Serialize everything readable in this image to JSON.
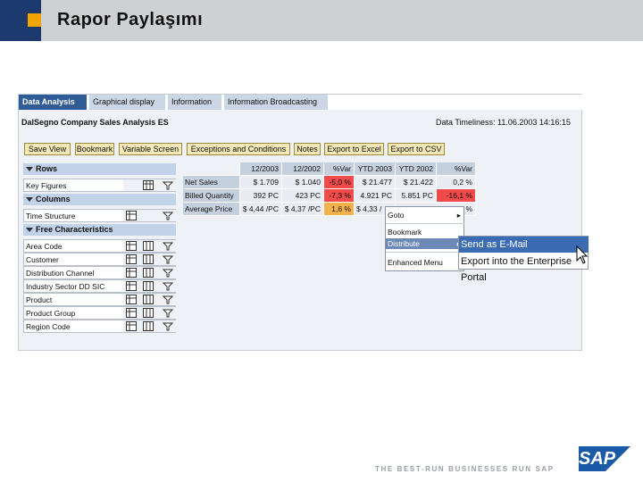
{
  "slide": {
    "title": "Rapor Paylaşımı",
    "tagline": "THE BEST-RUN BUSINESSES RUN SAP",
    "logo_text": "SAP"
  },
  "colors": {
    "header_bg": "#cfd0d2",
    "accent_blue": "#1c3a6e",
    "accent_orange": "#f0a500",
    "negative": "#f04a4a",
    "warning": "#f5b24a"
  },
  "tabs": [
    {
      "label": "Data Analysis"
    },
    {
      "label": "Graphical display"
    },
    {
      "label": "Information"
    },
    {
      "label": "Information Broadcasting"
    }
  ],
  "report": {
    "title": "DalSegno Company Sales Analysis ES",
    "timeliness": "Data Timeliness: 11.06.2003 14:16:15"
  },
  "toolbar": [
    {
      "label": "Save View"
    },
    {
      "label": "Bookmark"
    },
    {
      "label": "Variable Screen"
    },
    {
      "label": "Exceptions and Conditions"
    },
    {
      "label": "Notes"
    },
    {
      "label": "Export to Excel"
    },
    {
      "label": "Export to CSV"
    }
  ],
  "navigation": {
    "rows_header": "Rows",
    "rows": [
      {
        "label": "Key Figures"
      }
    ],
    "columns_header": "Columns",
    "columns": [
      {
        "label": "Time Structure"
      }
    ],
    "free_header": "Free Characteristics",
    "free": [
      {
        "label": "Area Code"
      },
      {
        "label": "Customer"
      },
      {
        "label": "Distribution Channel"
      },
      {
        "label": "Industry Sector DD SIC"
      },
      {
        "label": "Product"
      },
      {
        "label": "Product Group"
      },
      {
        "label": "Region Code"
      }
    ]
  },
  "table": {
    "headers": [
      "12/2003",
      "12/2002",
      "%Var",
      "YTD 2003",
      "YTD 2002",
      "%Var"
    ],
    "rows": [
      {
        "label": "Net Sales",
        "values": [
          "$ 1.709",
          "$ 1.040",
          "-5,0 %",
          "$ 21.477",
          "$ 21.422",
          "0,2 %"
        ]
      },
      {
        "label": "Billed Quantity",
        "values": [
          "392 PC",
          "423 PC",
          "-7,3 %",
          "4.921 PC",
          "5.851 PC",
          "-16,1 %"
        ]
      },
      {
        "label": "Average Price",
        "values": [
          "$ 4,44 /PC",
          "$ 4,37 /PC",
          "1,6 %",
          "$ 4,33 /",
          "",
          "%"
        ]
      }
    ]
  },
  "context_menu": {
    "items": [
      {
        "label": "Goto",
        "arrow": "▸"
      },
      {
        "label": "Bookmark",
        "arrow": ""
      },
      {
        "label": "Distribute",
        "arrow": "▸"
      },
      {
        "label": "Enhanced Menu",
        "arrow": ""
      }
    ],
    "submenu": [
      {
        "label": "Send as E-Mail"
      },
      {
        "label": "Export into the Enterprise Portal"
      }
    ]
  }
}
